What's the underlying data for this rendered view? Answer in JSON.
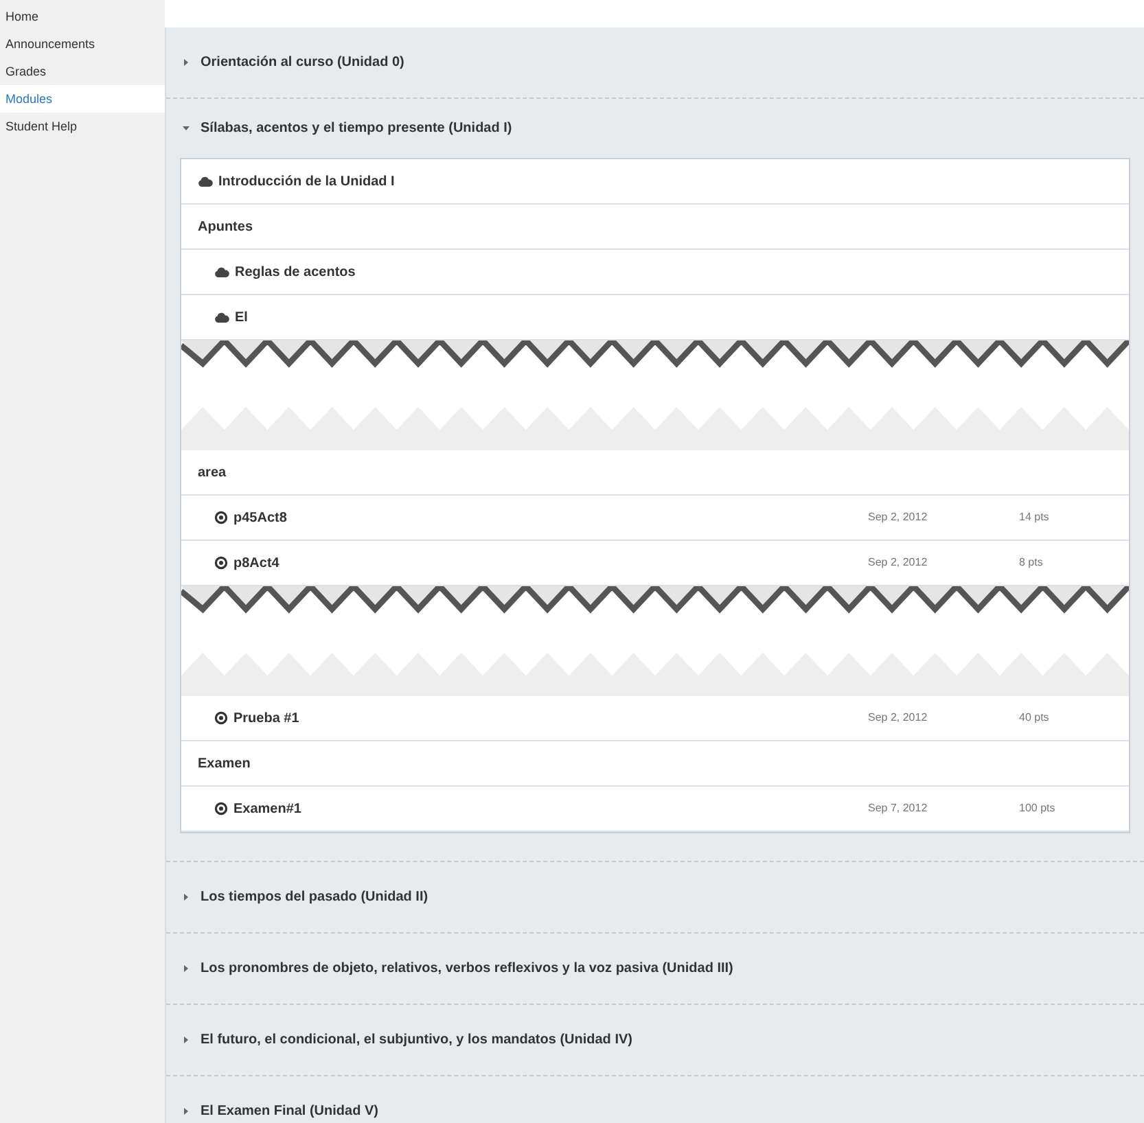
{
  "sidebar": {
    "items": [
      {
        "label": "Home",
        "selected": false
      },
      {
        "label": "Announcements",
        "selected": false
      },
      {
        "label": "Grades",
        "selected": false
      },
      {
        "label": "Modules",
        "selected": true
      },
      {
        "label": "Student Help",
        "selected": false
      }
    ]
  },
  "modules": [
    {
      "title": "Orientación al curso (Unidad 0)",
      "expanded": false
    },
    {
      "title": "Sílabas, acentos y el tiempo presente (Unidad I)",
      "expanded": true,
      "items": [
        {
          "kind": "page",
          "title": "Introducción de la Unidad I"
        },
        {
          "kind": "heading",
          "title": "Apuntes",
          "children": [
            {
              "kind": "page",
              "title": "Reglas de acentos"
            },
            {
              "kind": "page",
              "title": "El"
            }
          ]
        },
        {
          "kind": "break"
        },
        {
          "kind": "heading",
          "title": "area",
          "children": [
            {
              "kind": "assignment",
              "title": "p45Act8",
              "due": "Sep 2, 2012",
              "points": "14 pts"
            },
            {
              "kind": "assignment",
              "title": "p8Act4",
              "due": "Sep 2, 2012",
              "points": "8 pts"
            },
            {
              "kind": "break"
            },
            {
              "kind": "assignment",
              "title": "Prueba #1",
              "due": "Sep 2, 2012",
              "points": "40 pts"
            }
          ]
        },
        {
          "kind": "heading",
          "title": "Examen",
          "children": [
            {
              "kind": "assignment",
              "title": "Examen#1",
              "due": "Sep 7, 2012",
              "points": "100 pts"
            }
          ]
        }
      ]
    },
    {
      "title": "Los tiempos del pasado (Unidad II)",
      "expanded": false
    },
    {
      "title": "Los pronombres de objeto, relativos, verbos reflexivos y la voz pasiva (Unidad III)",
      "expanded": false
    },
    {
      "title": "El futuro, el condicional, el subjuntivo, y los mandatos (Unidad IV)",
      "expanded": false
    },
    {
      "title": "El Examen Final (Unidad V)",
      "expanded": false
    }
  ]
}
